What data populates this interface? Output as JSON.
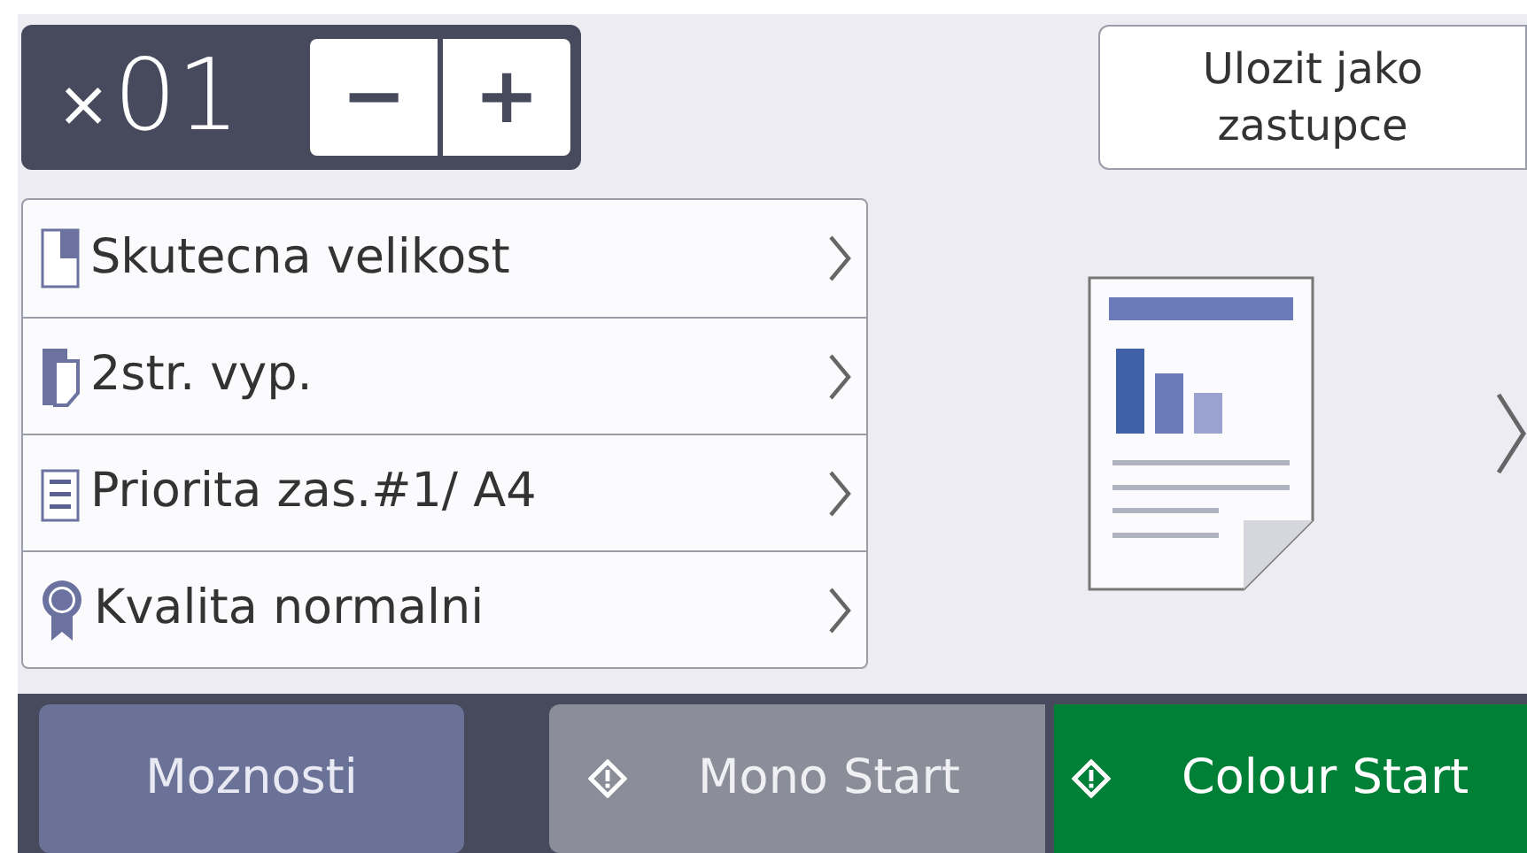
{
  "copies": {
    "prefix": "×",
    "value": "01",
    "decrease": "−",
    "increase": "+"
  },
  "save_button": {
    "label": "Ulozit jako zastupce"
  },
  "settings": [
    {
      "kind": "size",
      "label": "Skutecna velikost"
    },
    {
      "kind": "duplex",
      "label": "2str. vyp."
    },
    {
      "kind": "tray",
      "label": "Priorita zas.#1/ A4"
    },
    {
      "kind": "quality",
      "label": "Kvalita normalni"
    }
  ],
  "bottom_bar": [
    {
      "kind": "options",
      "label": "Moznosti"
    },
    {
      "kind": "mono",
      "label": "Mono Start"
    },
    {
      "kind": "colour",
      "label": "Colour Start"
    }
  ]
}
